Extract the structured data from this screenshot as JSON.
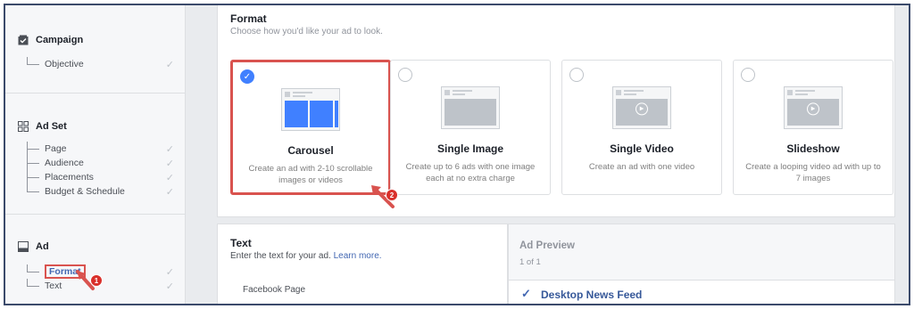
{
  "sidebar": {
    "campaign": {
      "label": "Campaign",
      "icon": "campaign-check-icon",
      "items": [
        {
          "label": "Objective"
        }
      ]
    },
    "adset": {
      "label": "Ad Set",
      "icon": "adset-grid-icon",
      "items": [
        {
          "label": "Page"
        },
        {
          "label": "Audience"
        },
        {
          "label": "Placements"
        },
        {
          "label": "Budget & Schedule"
        }
      ]
    },
    "ad": {
      "label": "Ad",
      "icon": "ad-layout-icon",
      "items": [
        {
          "label": "Format"
        },
        {
          "label": "Text"
        }
      ]
    }
  },
  "annotations": {
    "badge1": "1",
    "badge2": "2"
  },
  "format": {
    "title": "Format",
    "subtitle": "Choose how you'd like your ad to look.",
    "options": [
      {
        "title": "Carousel",
        "desc": "Create an ad with 2-10 scrollable images or videos",
        "selected": true
      },
      {
        "title": "Single Image",
        "desc": "Create up to 6 ads with one image each at no extra charge",
        "selected": false
      },
      {
        "title": "Single Video",
        "desc": "Create an ad with one video",
        "selected": false
      },
      {
        "title": "Slideshow",
        "desc": "Create a looping video ad with up to 7 images",
        "selected": false
      }
    ]
  },
  "text_section": {
    "title": "Text",
    "subtitle": "Enter the text for your ad.",
    "learn_more": "Learn more.",
    "facebook_page": "Facebook Page"
  },
  "preview": {
    "title": "Ad Preview",
    "count": "1 of 1",
    "placement": "Desktop News Feed"
  },
  "colors": {
    "accent": "#4080ff",
    "highlight": "#d9534f",
    "link": "#4267b2"
  }
}
